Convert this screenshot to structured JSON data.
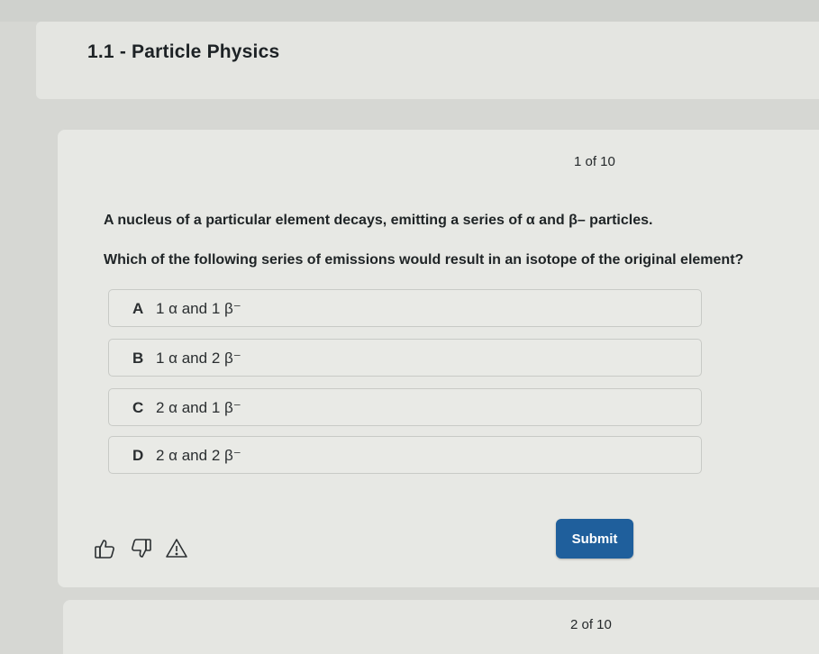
{
  "header": {
    "title": "1.1 - Particle Physics"
  },
  "question": {
    "counter": "1 of 10",
    "stem_line1": "A nucleus of a particular element decays, emitting a series of α and β– particles.",
    "stem_line2": "Which of the following series of emissions would result in an isotope of the original element?",
    "options": [
      {
        "letter": "A",
        "text": "1 α and 1 β⁻"
      },
      {
        "letter": "B",
        "text": "1 α and 2 β⁻"
      },
      {
        "letter": "C",
        "text": "2 α and 1 β⁻"
      },
      {
        "letter": "D",
        "text": "2 α and 2 β⁻"
      }
    ],
    "icons": [
      "thumbs-up-icon",
      "thumbs-down-icon",
      "warning-icon"
    ],
    "submit_label": "Submit"
  },
  "next_question": {
    "counter": "2 of 10"
  },
  "colors": {
    "submit_bg": "#1f5f9c",
    "background": "#d6d7d3",
    "card": "#e7e8e4"
  }
}
